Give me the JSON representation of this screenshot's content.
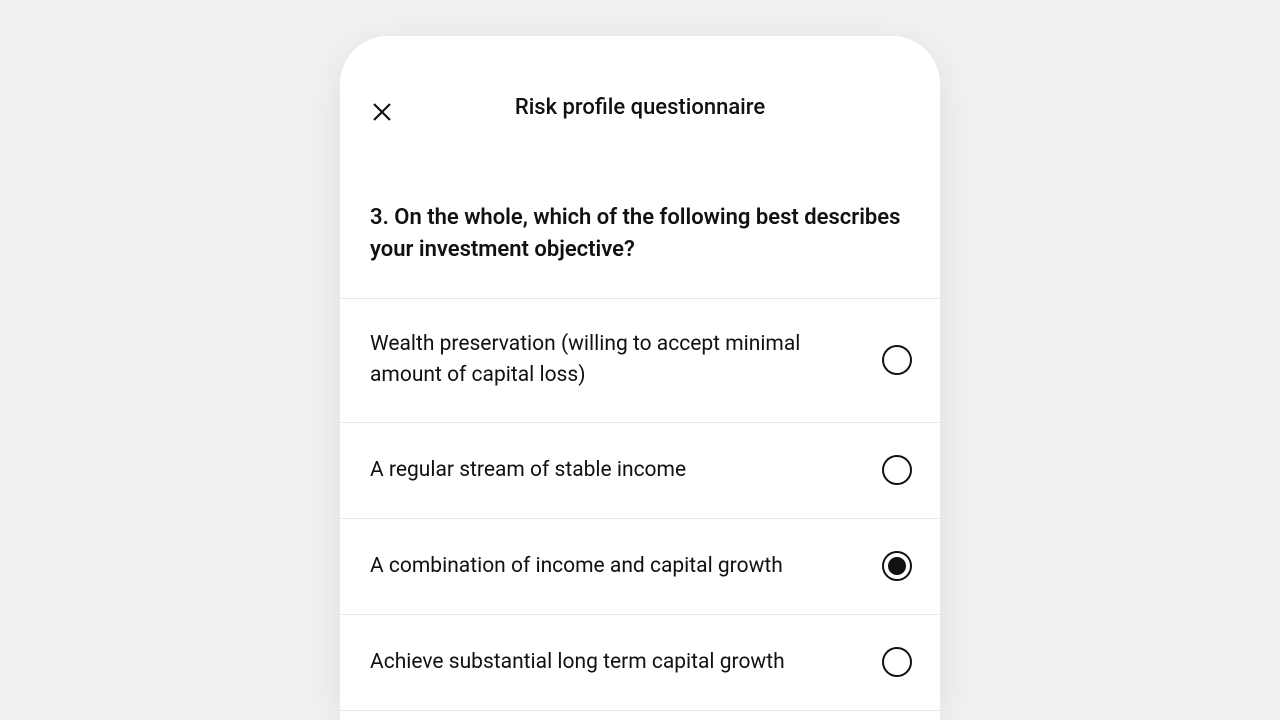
{
  "header": {
    "title": "Risk profile questionnaire"
  },
  "question": {
    "text": "3. On the whole, which of the following best describes your investment objective?"
  },
  "options": [
    {
      "label": "Wealth preservation (willing to accept minimal amount of capital loss)",
      "selected": false
    },
    {
      "label": "A regular stream of stable income",
      "selected": false
    },
    {
      "label": "A combination of income and capital growth",
      "selected": true
    },
    {
      "label": "Achieve substantial long term capital growth",
      "selected": false
    }
  ]
}
